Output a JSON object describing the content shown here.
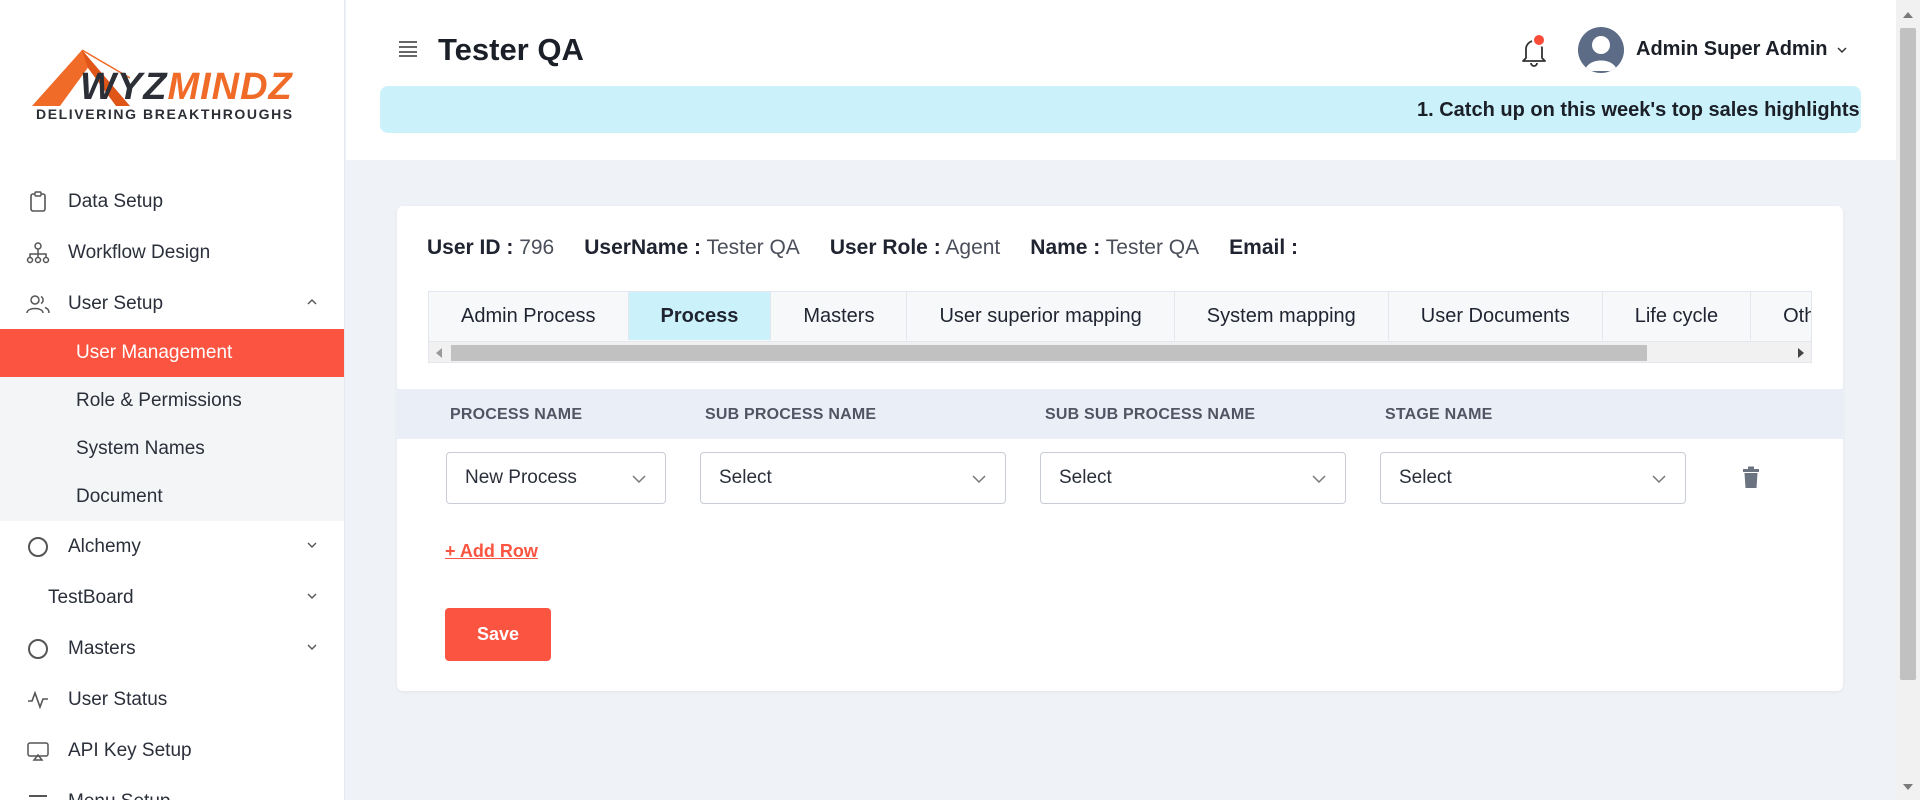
{
  "logo": {
    "brand_part1": "WYZ",
    "brand_part2": "MINDZ",
    "tagline": "DELIVERING  BREAKTHROUGHS"
  },
  "sidebar": {
    "items": [
      {
        "label": "Data Setup",
        "icon": "clipboard-icon"
      },
      {
        "label": "Workflow Design",
        "icon": "workflow-icon"
      },
      {
        "label": "User Setup",
        "icon": "users-icon",
        "expanded": true
      },
      {
        "label": "Alchemy",
        "icon": "circle-icon"
      },
      {
        "label": "TestBoard"
      },
      {
        "label": "Masters",
        "icon": "circle-icon"
      },
      {
        "label": "User Status",
        "icon": "activity-icon"
      },
      {
        "label": "API Key Setup",
        "icon": "monitor-icon"
      },
      {
        "label": "Menu Setup",
        "icon": "menu-icon"
      }
    ],
    "user_setup_children": [
      "User Management",
      "Role & Permissions",
      "System Names",
      "Document"
    ],
    "active_child": "User Management"
  },
  "header": {
    "title": "Tester QA",
    "user_name": "Admin Super Admin",
    "banner_text": "1. Catch up on this week's top sales highlights"
  },
  "user_info": {
    "user_id_label": "User ID :",
    "user_id": "796",
    "username_label": "UserName :",
    "username": "Tester QA",
    "role_label": "User Role :",
    "role": "Agent",
    "name_label": "Name :",
    "name": "Tester QA",
    "email_label": "Email :",
    "email": ""
  },
  "tabs": [
    "Admin Process",
    "Process",
    "Masters",
    "User superior mapping",
    "System mapping",
    "User Documents",
    "Life cycle",
    "Others"
  ],
  "active_tab": "Process",
  "table": {
    "headers": [
      "PROCESS NAME",
      "SUB PROCESS NAME",
      "SUB SUB PROCESS NAME",
      "STAGE NAME"
    ],
    "row": [
      "New Process",
      "Select",
      "Select",
      "Select"
    ]
  },
  "actions": {
    "add_row": "+ Add Row",
    "save": "Save"
  },
  "colors": {
    "accent": "#fb5440",
    "banner": "#cbf1fa",
    "active_tab": "#cbf1fa",
    "logo_orange": "#f06a28"
  }
}
